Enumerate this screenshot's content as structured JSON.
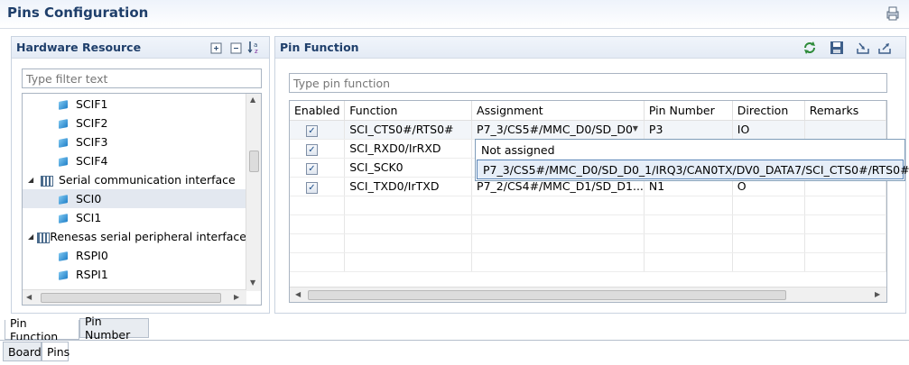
{
  "page": {
    "title": "Pins Configuration"
  },
  "hardware": {
    "title": "Hardware Resource",
    "filter_placeholder": "Type filter text",
    "tree": [
      {
        "label": "SCIF1",
        "kind": "leaf"
      },
      {
        "label": "SCIF2",
        "kind": "leaf"
      },
      {
        "label": "SCIF3",
        "kind": "leaf"
      },
      {
        "label": "SCIF4",
        "kind": "leaf"
      },
      {
        "label": "Serial communication interface",
        "kind": "group"
      },
      {
        "label": "SCI0",
        "kind": "leaf",
        "selected": true
      },
      {
        "label": "SCI1",
        "kind": "leaf"
      },
      {
        "label": "Renesas serial peripheral interface",
        "kind": "group"
      },
      {
        "label": "RSPI0",
        "kind": "leaf"
      },
      {
        "label": "RSPI1",
        "kind": "leaf"
      }
    ]
  },
  "pinfunc": {
    "title": "Pin Function",
    "filter_placeholder": "Type pin function",
    "columns": [
      "Enabled",
      "Function",
      "Assignment",
      "Pin Number",
      "Direction",
      "Remarks"
    ],
    "rows": [
      {
        "enabled": true,
        "function": "SCI_CTS0#/RTS0#",
        "assignment": "P7_3/CS5#/MMC_D0/SD_D0",
        "pin": "P3",
        "direction": "IO",
        "remarks": ""
      },
      {
        "enabled": true,
        "function": "SCI_RXD0/IrRXD",
        "assignment": "",
        "pin": "",
        "direction": "",
        "remarks": ""
      },
      {
        "enabled": true,
        "function": "SCI_SCK0",
        "assignment": "",
        "pin": "",
        "direction": "",
        "remarks": ""
      },
      {
        "enabled": true,
        "function": "SCI_TXD0/IrTXD",
        "assignment": "P7_2/CS4#/MMC_D1/SD_D1...",
        "pin": "N1",
        "direction": "O",
        "remarks": ""
      }
    ],
    "dropdown_options": [
      "Not assigned",
      "P7_3/CS5#/MMC_D0/SD_D0_1/IRQ3/CAN0TX/DV0_DATA7/SCI_CTS0#/RTS0#"
    ]
  },
  "bottom_tabs": {
    "view": [
      "Pin Function",
      "Pin Number"
    ],
    "editor": [
      "Board",
      "Pins"
    ]
  },
  "colors": {
    "title": "#1f3f6b",
    "accent": "#1f7fc8"
  }
}
